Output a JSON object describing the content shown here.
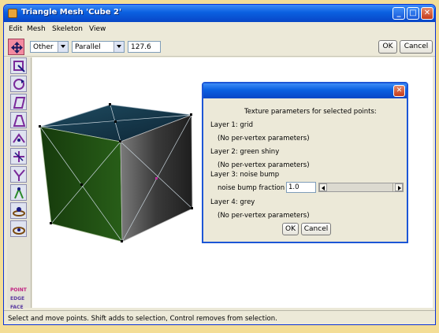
{
  "window": {
    "title": "Triangle Mesh 'Cube 2'",
    "controls": [
      "minimize-icon",
      "maximize-icon",
      "close-icon"
    ]
  },
  "menu": [
    "Edit",
    "Mesh",
    "Skeleton",
    "View"
  ],
  "toolbar": {
    "view_select": "Other",
    "projection_select": "Parallel",
    "zoom_value": "127.6",
    "ok_label": "OK",
    "cancel_label": "Cancel"
  },
  "tools": [
    "move-points-icon",
    "scale-icon",
    "rotate-icon",
    "skew-icon",
    "taper-icon",
    "bevel-icon",
    "thicken-icon",
    "add-point-icon",
    "create-vertex-icon",
    "rotate-view-icon",
    "move-view-icon"
  ],
  "modes": {
    "point": "POINT",
    "edge": "EDGE",
    "face": "FACE"
  },
  "status": "Select and move points.  Shift adds to selection, Control removes from selection.",
  "dialog": {
    "heading": "Texture parameters for selected points:",
    "layers": [
      {
        "label": "Layer 1: grid",
        "note": "(No per-vertex parameters)"
      },
      {
        "label": "Layer 2: green shiny",
        "note": "(No per-vertex parameters)"
      },
      {
        "label": "Layer 3: noise bump",
        "param_label": "noise bump fraction",
        "param_value": "1.0"
      },
      {
        "label": "Layer 4: grey",
        "note": "(No per-vertex parameters)"
      }
    ],
    "noise_bump_fraction": 1.0,
    "ok_label": "OK",
    "cancel_label": "Cancel"
  },
  "colors": {
    "titlebar": "#0a5fe0",
    "cube_top": "#15364a",
    "cube_left": "#1d4a10",
    "cube_right": "#5c5c5c",
    "selected_tool": "#f28aa0"
  }
}
